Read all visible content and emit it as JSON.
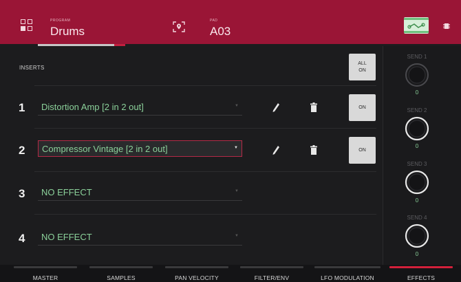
{
  "header": {
    "program_label": "PROGRAM",
    "program_value": "Drums",
    "pad_label": "PAD",
    "pad_value": "A03"
  },
  "inserts": {
    "title": "INSERTS",
    "all_on_line1": "ALL",
    "all_on_line2": "ON",
    "slots": [
      {
        "number": "1",
        "effect": "Distortion Amp [2 in 2 out]",
        "on_label": "ON"
      },
      {
        "number": "2",
        "effect": "Compressor Vintage [2 in 2 out]",
        "on_label": "ON"
      },
      {
        "number": "3",
        "effect": "NO EFFECT"
      },
      {
        "number": "4",
        "effect": "NO EFFECT"
      }
    ]
  },
  "sends": [
    {
      "label": "SEND 1",
      "value": "0"
    },
    {
      "label": "SEND 2",
      "value": "0"
    },
    {
      "label": "SEND 3",
      "value": "0"
    },
    {
      "label": "SEND 4",
      "value": "0"
    }
  ],
  "tabs": [
    {
      "label": "MASTER",
      "active": false
    },
    {
      "label": "SAMPLES",
      "active": false
    },
    {
      "label": "PAN VELOCITY",
      "active": false
    },
    {
      "label": "FILTER/ENV",
      "active": false
    },
    {
      "label": "LFO MODULATION",
      "active": false
    },
    {
      "label": "EFFECTS",
      "active": true
    }
  ],
  "colors": {
    "header": "#9a1536",
    "accent": "#d3203b",
    "effect_text": "#8bd19a",
    "background": "#1c1c1e"
  },
  "icons": [
    "grid-icon",
    "pad-location-icon",
    "routing-icon",
    "chip-icon",
    "edit-icon",
    "trash-icon",
    "dropdown-caret-icon"
  ]
}
